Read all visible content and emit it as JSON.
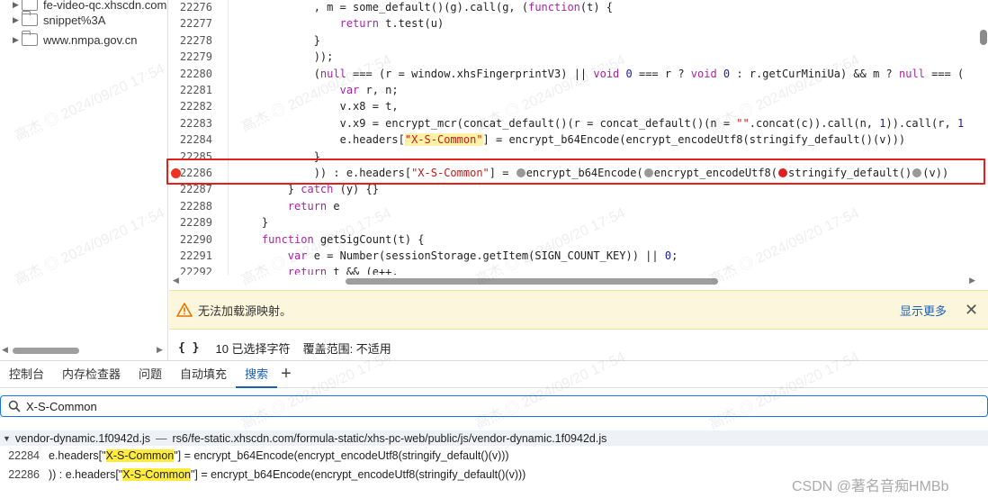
{
  "tree": {
    "items": [
      {
        "label": "fe-video-qc.xhscdn.com"
      },
      {
        "label": "snippet%3A"
      },
      {
        "label": "www.nmpa.gov.cn"
      }
    ]
  },
  "editor": {
    "lines": [
      {
        "num": "22276",
        "html": "            , m = some_default()(g).call(g, (<span class=\"kw\">function</span>(t) {"
      },
      {
        "num": "22277",
        "html": "                <span class=\"kw\">return</span> t.test(u)"
      },
      {
        "num": "22278",
        "html": "            }"
      },
      {
        "num": "22279",
        "html": "            ));"
      },
      {
        "num": "22280",
        "html": "            (<span class=\"kw\">null</span> === (r = window.xhsFingerprintV3) || <span class=\"kw\">void</span> <span class=\"num\">0</span> === r ? <span class=\"kw\">void</span> <span class=\"num\">0</span> : r.getCurMiniUa) && m ? <span class=\"kw\">null</span> === ("
      },
      {
        "num": "22281",
        "html": "                <span class=\"kw\">var</span> r, n;"
      },
      {
        "num": "22282",
        "html": "                v.x8 = t,"
      },
      {
        "num": "22283",
        "html": "                v.x9 = encrypt_mcr(concat_default()(r = concat_default()(n = <span class=\"str\">\"\"</span>.concat(c)).call(n, <span class=\"num\">1</span>)).call(r, <span class=\"num\">1</span>"
      },
      {
        "num": "22284",
        "html": "                e.headers[<span class=\"str\"><span class=\"hl\">\"X-S-Common\"</span></span>] = encrypt_b64Encode(encrypt_encodeUtf8(stringify_default()(v)))"
      },
      {
        "num": "22285",
        "html": "            }"
      },
      {
        "num": "22286",
        "html": "            )) : e.headers[<span class=\"str\">\"X-S-Common\"</span>] = <span class=\"dot\"></span>encrypt_b64Encode(<span class=\"dot\"></span>encrypt_encodeUtf8(<span class=\"dot red\"></span>stringify_default()<span class=\"dot\"></span>(v))"
      },
      {
        "num": "22287",
        "html": "        } <span class=\"kw\">catch</span> (y) {}"
      },
      {
        "num": "22288",
        "html": "        <span class=\"kw\">return</span> e"
      },
      {
        "num": "22289",
        "html": "    }"
      },
      {
        "num": "22290",
        "html": "    <span class=\"kw\">function</span> getSigCount(t) {"
      },
      {
        "num": "22291",
        "html": "        <span class=\"kw\">var</span> e = Number(sessionStorage.getItem(SIGN_COUNT_KEY)) || <span class=\"num\">0</span>;"
      },
      {
        "num": "22292",
        "html": "        <span class=\"kw\">return</span> t && (e++,"
      }
    ]
  },
  "warning": {
    "text": "无法加载源映射。",
    "more": "显示更多"
  },
  "status": {
    "braces": "{ }",
    "selection": "10 已选择字符",
    "coverage": "覆盖范围: 不适用"
  },
  "tabs": [
    {
      "label": "控制台"
    },
    {
      "label": "内存检查器"
    },
    {
      "label": "问题"
    },
    {
      "label": "自动填充"
    },
    {
      "label": "搜索"
    }
  ],
  "search": {
    "value": "X-S-Common"
  },
  "results": {
    "file": "vendor-dynamic.1f0942d.js",
    "separator": "—",
    "path": "rs6/fe-static.xhscdn.com/formula-static/xhs-pc-web/public/js/vendor-dynamic.1f0942d.js",
    "matches": [
      {
        "line": "22284",
        "before": "e.headers[\"",
        "match": "X-S-Common",
        "after": "\"] = encrypt_b64Encode(encrypt_encodeUtf8(stringify_default()(v)))"
      },
      {
        "line": "22286",
        "before": ")) : e.headers[\"",
        "match": "X-S-Common",
        "after": "\"] = encrypt_b64Encode(encrypt_encodeUtf8(stringify_default()(v)))"
      }
    ]
  },
  "watermark": "高杰 ◎ 2024/09/20 17:54",
  "csdn": "CSDN @著名音痴HMBb",
  "colors": {
    "accent": "#1a5fb4",
    "breakpoint": "#e32",
    "highlight_box": "#e3211a",
    "search_match": "#ffeb3b",
    "warning_bg": "#fcf6dc"
  }
}
